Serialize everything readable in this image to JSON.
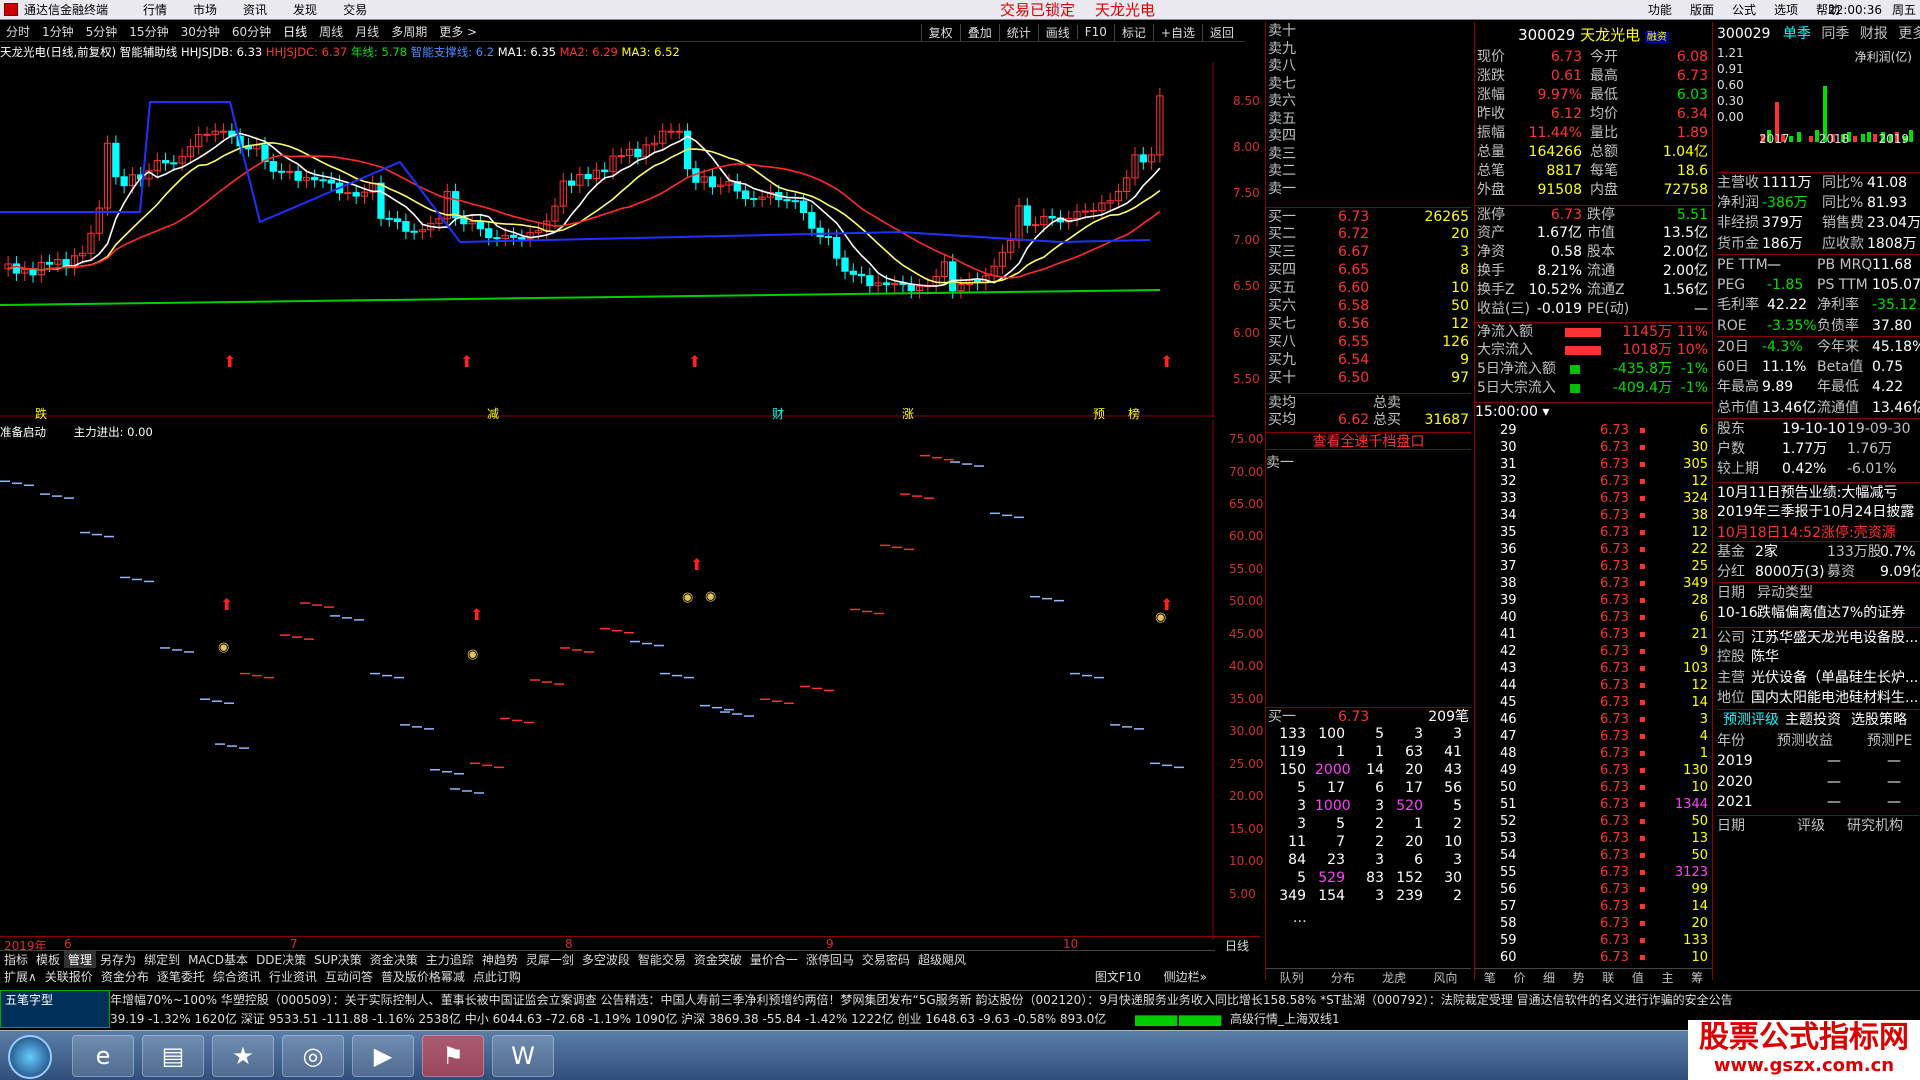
{
  "title_bar": {
    "app": "通达信金融终端",
    "menus": [
      "行情",
      "市场",
      "资讯",
      "发现",
      "交易"
    ],
    "lock_text": "交易已锁定",
    "stock_name": "天龙光电",
    "right_menus": [
      "功能",
      "版面",
      "公式",
      "选项",
      "帮助"
    ],
    "time": "22:00:36",
    "extra": "周五"
  },
  "toolbar": {
    "items": [
      "分时",
      "1分钟",
      "5分钟",
      "15分钟",
      "30分钟",
      "60分钟",
      "日线",
      "周线",
      "月线",
      "多周期",
      "更多 >"
    ],
    "selected": "日线",
    "right": [
      "复权",
      "叠加",
      "统计",
      "画线",
      "F10",
      "标记",
      "+自选",
      "返回"
    ]
  },
  "info_bar": {
    "stock": "天龙光电(日线,前复权)",
    "assist": "智能辅助线",
    "hhjsjdb": "HHJSJDB: 6.33",
    "hhjsjdc": "HHJSJDC: 6.37",
    "yearline": "年线: 5.78",
    "zhineng": "智能支撑线: 6.2",
    "ma1": "MA1: 6.35",
    "ma2": "MA2: 6.29",
    "ma3": "MA3: 6.52"
  },
  "kchart": {
    "price_labels": [
      "8.50",
      "8.00",
      "7.50",
      "7.00",
      "6.50",
      "6.00",
      "5.50"
    ],
    "bottom_marks": [
      "跌",
      "减",
      "财",
      "涨",
      "预",
      "榜"
    ],
    "color_up": "#ff3232",
    "color_down": "#00ffff"
  },
  "indicator": {
    "name": "准备启动",
    "main_flow": "主力进出: 0.00",
    "labels": [
      "75.00",
      "70.00",
      "65.00",
      "60.00",
      "55.00",
      "50.00",
      "45.00",
      "40.00",
      "35.00",
      "30.00",
      "25.00",
      "20.00",
      "15.00",
      "10.00",
      "5.00"
    ],
    "x_labels": [
      "2019年",
      "6",
      "7",
      "8",
      "9",
      "10"
    ],
    "period": "日线"
  },
  "bottom_tabs": [
    "指标",
    "模板",
    "管理",
    "另存为",
    "绑定到",
    "MACD基本",
    "DDE决策",
    "SUP决策",
    "资金决策",
    "主力追踪",
    "神趋势",
    "灵犀一剑",
    "多空波段",
    "智能交易",
    "资金突破",
    "量价合一",
    "涨停回马",
    "交易密码",
    "超级飓风"
  ],
  "bottom_tabs_active": "管理",
  "bottom_tabs2": [
    "扩展∧",
    "关联报价",
    "资金分布",
    "逐笔委托",
    "综合资讯",
    "行业资讯",
    "互动问答",
    "普及版价格幂减",
    "点此订购"
  ],
  "bottom_right": [
    "图文F10",
    "侧边栏»"
  ],
  "orderbook": {
    "sell": [
      {
        "l": "卖十"
      },
      {
        "l": "卖九"
      },
      {
        "l": "卖八"
      },
      {
        "l": "卖七"
      },
      {
        "l": "卖六"
      },
      {
        "l": "卖五"
      },
      {
        "l": "卖四"
      },
      {
        "l": "卖三"
      },
      {
        "l": "卖二"
      },
      {
        "l": "卖一"
      }
    ],
    "buy": [
      {
        "l": "买一",
        "p": "6.73",
        "v": "26265"
      },
      {
        "l": "买二",
        "p": "6.72",
        "v": "20"
      },
      {
        "l": "买三",
        "p": "6.67",
        "v": "3"
      },
      {
        "l": "买四",
        "p": "6.65",
        "v": "8"
      },
      {
        "l": "买五",
        "p": "6.60",
        "v": "10"
      },
      {
        "l": "买六",
        "p": "6.58",
        "v": "50"
      },
      {
        "l": "买七",
        "p": "6.56",
        "v": "12"
      },
      {
        "l": "买八",
        "p": "6.55",
        "v": "126"
      },
      {
        "l": "买九",
        "p": "6.54",
        "v": "9"
      },
      {
        "l": "买十",
        "p": "6.50",
        "v": "97"
      }
    ],
    "avg_sell": "卖均",
    "avg_buy": "买均",
    "avg_buy_p": "6.62",
    "total_sell": "总卖",
    "total_buy": "总买",
    "total_buy_v": "31687",
    "link": "查看全速千档盘口",
    "sell1": "卖一",
    "buy1": "买一",
    "buy1_p": "6.73",
    "buy1_n": "209笔",
    "queue": [
      [
        "133",
        "100",
        "5",
        "3",
        "3"
      ],
      [
        "119",
        "1",
        "1",
        "63",
        "41"
      ],
      [
        "150",
        "2000",
        "14",
        "20",
        "43"
      ],
      [
        "5",
        "17",
        "6",
        "17",
        "56"
      ],
      [
        "3",
        "1000",
        "3",
        "520",
        "5"
      ],
      [
        "3",
        "5",
        "2",
        "1",
        "2"
      ],
      [
        "11",
        "7",
        "2",
        "20",
        "10"
      ],
      [
        "84",
        "23",
        "3",
        "6",
        "3"
      ],
      [
        "5",
        "529",
        "83",
        "152",
        "30"
      ],
      [
        "349",
        "154",
        "3",
        "239",
        "2"
      ]
    ],
    "tabs": [
      "队列",
      "分布",
      "龙虎",
      "风向"
    ]
  },
  "quote": {
    "code": "300029",
    "name": "天龙光电",
    "tag": "融资",
    "rows": [
      [
        "现价",
        "6.73",
        "今开",
        "6.08"
      ],
      [
        "涨跌",
        "0.61",
        "最高",
        "6.73"
      ],
      [
        "涨幅",
        "9.97%",
        "最低",
        "6.03"
      ],
      [
        "昨收",
        "6.12",
        "均价",
        "6.34"
      ],
      [
        "振幅",
        "11.44%",
        "量比",
        "1.89"
      ],
      [
        "总量",
        "164266",
        "总额",
        "1.04亿"
      ],
      [
        "总笔",
        "8817",
        "每笔",
        "18.6"
      ],
      [
        "外盘",
        "91508",
        "内盘",
        "72758"
      ]
    ],
    "rows2": [
      [
        "涨停",
        "6.73",
        "跌停",
        "5.51"
      ],
      [
        "资产",
        "1.67亿",
        "市值",
        "13.5亿"
      ],
      [
        "净资",
        "0.58",
        "股本",
        "2.00亿"
      ],
      [
        "换手",
        "8.21%",
        "流通",
        "2.00亿"
      ],
      [
        "换手Z",
        "10.52%",
        "流通Z",
        "1.56亿"
      ],
      [
        "收益(三)",
        "-0.019",
        "PE(动)",
        "—"
      ]
    ],
    "flows": [
      [
        "净流入额",
        "1145万",
        "11%"
      ],
      [
        "大宗流入",
        "1018万",
        "10%"
      ],
      [
        "5日净流入额",
        "-435.8万",
        "-1%"
      ],
      [
        "5日大宗流入",
        "-409.4万",
        "-1%"
      ]
    ],
    "ticks_header": "15:00:00",
    "ticks": [
      [
        "29",
        "6.73",
        "6"
      ],
      [
        "30",
        "6.73",
        "30"
      ],
      [
        "31",
        "6.73",
        "305"
      ],
      [
        "32",
        "6.73",
        "12"
      ],
      [
        "33",
        "6.73",
        "324"
      ],
      [
        "34",
        "6.73",
        "38"
      ],
      [
        "35",
        "6.73",
        "12"
      ],
      [
        "36",
        "6.73",
        "22"
      ],
      [
        "37",
        "6.73",
        "25"
      ],
      [
        "38",
        "6.73",
        "349"
      ],
      [
        "39",
        "6.73",
        "28"
      ],
      [
        "40",
        "6.73",
        "6"
      ],
      [
        "41",
        "6.73",
        "21"
      ],
      [
        "42",
        "6.73",
        "9"
      ],
      [
        "43",
        "6.73",
        "103"
      ],
      [
        "44",
        "6.73",
        "12"
      ],
      [
        "45",
        "6.73",
        "14"
      ],
      [
        "46",
        "6.73",
        "3"
      ],
      [
        "47",
        "6.73",
        "4"
      ],
      [
        "48",
        "6.73",
        "1"
      ],
      [
        "49",
        "6.73",
        "130"
      ],
      [
        "50",
        "6.73",
        "10"
      ],
      [
        "51",
        "6.73",
        "1344"
      ],
      [
        "52",
        "6.73",
        "50"
      ],
      [
        "53",
        "6.73",
        "13"
      ],
      [
        "54",
        "6.73",
        "50"
      ],
      [
        "55",
        "6.73",
        "3123"
      ],
      [
        "56",
        "6.73",
        "99"
      ],
      [
        "57",
        "6.73",
        "14"
      ],
      [
        "58",
        "6.73",
        "20"
      ],
      [
        "59",
        "6.73",
        "133"
      ],
      [
        "60",
        "6.73",
        "10"
      ]
    ],
    "tabs": [
      "笔",
      "价",
      "细",
      "势",
      "联",
      "值",
      "主",
      "筹"
    ]
  },
  "right": {
    "code": "300029",
    "tabs": [
      "单季",
      "同季",
      "财报",
      "更多..."
    ],
    "chart_title": "净利润(亿)",
    "chart_y": [
      "1.21",
      "0.91",
      "0.60",
      "0.30",
      "0.00"
    ],
    "chart_x": [
      "2017",
      "2018",
      "2019"
    ],
    "fin": [
      [
        "主营收",
        "1111万",
        "同比%",
        "41.08"
      ],
      [
        "净利润",
        "-386万",
        "同比%",
        "81.93"
      ],
      [
        "非经损",
        "379万",
        "销售费",
        "23.04万"
      ],
      [
        "货币金",
        "186万",
        "应收款",
        "1808万"
      ]
    ],
    "val": [
      [
        "PE TTM",
        "—",
        "PB MRQ",
        "11.68"
      ],
      [
        "PEG",
        "-1.85",
        "PS TTM",
        "105.07"
      ],
      [
        "毛利率",
        "42.22",
        "净利率",
        "-35.12"
      ],
      [
        "ROE",
        "-3.35%",
        "负债率",
        "37.80"
      ]
    ],
    "perf": [
      [
        "20日",
        "-4.3%",
        "今年来",
        "45.18%"
      ],
      [
        "60日",
        "11.1%",
        "Beta值",
        "0.75"
      ],
      [
        "年最高",
        "9.89",
        "年最低",
        "4.22"
      ],
      [
        "总市值",
        "13.46亿",
        "流通值",
        "13.46亿"
      ]
    ],
    "holder": [
      [
        "股东",
        "19-10-10",
        "19-09-30"
      ],
      [
        "户数",
        "1.77万",
        "1.76万"
      ],
      [
        "较上期",
        "0.42%",
        "-6.01%"
      ]
    ],
    "news1": "10月11日预告业绩:大幅减亏",
    "news2": "2019年三季报于10月24日披露",
    "news3": "10月18日14:52涨停:壳资源",
    "fund": [
      [
        "基金",
        "2家",
        "133万股",
        "0.7%"
      ],
      [
        "分红",
        "8000万(3)",
        "募资",
        "9.09亿(1)"
      ]
    ],
    "event": [
      "日期",
      "异动类型"
    ],
    "event_row": [
      "10-16",
      "跌幅偏离值达7%的证券"
    ],
    "company": [
      [
        "公司",
        "江苏华盛天龙光电设备股..."
      ],
      [
        "控股",
        "陈华"
      ],
      [
        "主营",
        "光伏设备（单晶硅生长炉..."
      ],
      [
        "地位",
        "国内太阳能电池硅材料生..."
      ]
    ],
    "rating_tabs": [
      "预测评级",
      "主题投资",
      "选股策略"
    ],
    "forecast_head": [
      "年份",
      "预测收益",
      "预测PE"
    ],
    "forecast": [
      [
        "2019",
        "—",
        "—"
      ],
      [
        "2020",
        "—",
        "—"
      ],
      [
        "2021",
        "—",
        "—"
      ]
    ],
    "rating_head": [
      "日期",
      "评级",
      "研究机构"
    ]
  },
  "ticker": "年增幅70%~100%    华塑控股（000509）：关于实际控制人、董事长被中国证监会立案调查    公告精选：中国人寿前三季净利预增约两倍！梦网集团发布“5G服务新    韵达股份（002120）：9月快递服务业务收入同比增长158.58%    *ST盐湖（000792）：法院裁定受理    冒通达信软件的名义进行诈骗的安全公告",
  "indexbar": "39.19  -1.32%  1620亿    深证 9533.51  -111.88  -1.16%  2538亿    中小 6044.63  -72.68  -1.19%  1090亿    沪深 3869.38  -55.84  -1.42%  1222亿    创业 1648.63  -9.63  -0.58%  893.0亿",
  "status": "高级行情_上海双线1",
  "ime": "五笔字型",
  "watermark": {
    "title": "股票公式指标网",
    "url": "www.gszx.com.cn"
  }
}
